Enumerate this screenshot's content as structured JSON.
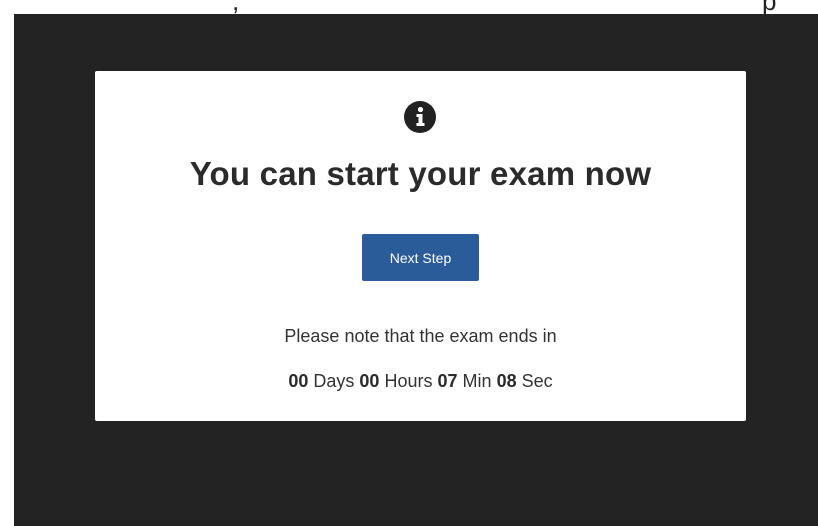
{
  "top_strip": {
    "partial_text": ",",
    "partial_text_right": "p"
  },
  "modal": {
    "icon": "info-circle-icon",
    "title": "You can start your exam now",
    "next_button_label": "Next Step",
    "notice": "Please note that the exam ends in",
    "countdown": {
      "days_value": "00",
      "days_unit": "Days",
      "hours_value": "00",
      "hours_unit": "Hours",
      "minutes_value": "07",
      "minutes_unit": "Min",
      "seconds_value": "08",
      "seconds_unit": "Sec"
    }
  },
  "colors": {
    "overlay": "#232323",
    "button": "#2a5c9a"
  }
}
